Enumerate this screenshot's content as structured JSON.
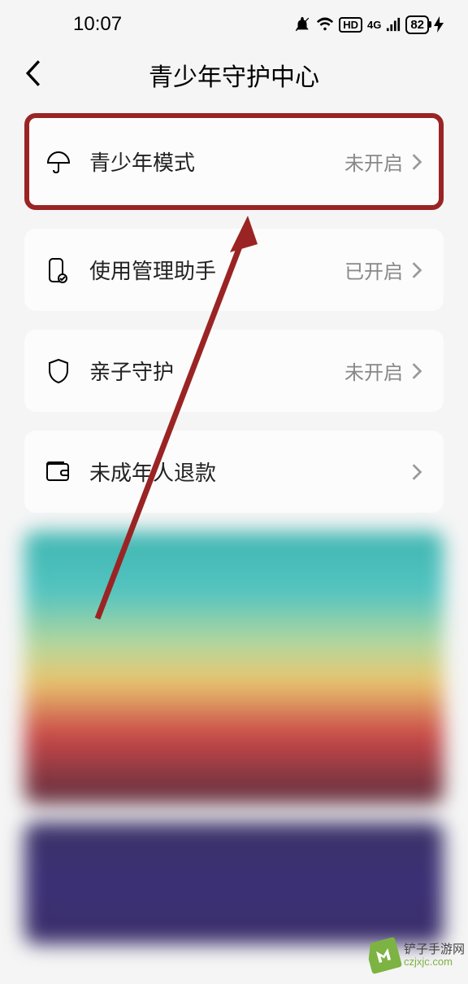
{
  "statusBar": {
    "time": "10:07",
    "network": "4G",
    "hd": "HD",
    "battery": "82"
  },
  "header": {
    "title": "青少年守护中心"
  },
  "items": [
    {
      "label": "青少年模式",
      "status": "未开启",
      "icon": "umbrella"
    },
    {
      "label": "使用管理助手",
      "status": "已开启",
      "icon": "phone-check"
    },
    {
      "label": "亲子守护",
      "status": "未开启",
      "icon": "shield"
    },
    {
      "label": "未成年人退款",
      "status": "",
      "icon": "wallet"
    }
  ],
  "watermark": {
    "title": "铲子手游网",
    "url": "czjxjc.com"
  }
}
